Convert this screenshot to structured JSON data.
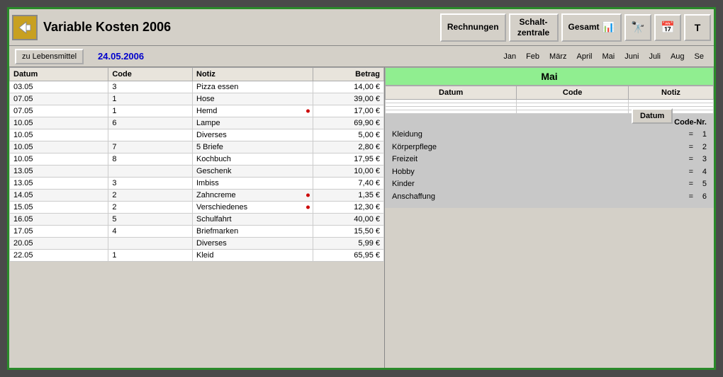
{
  "window": {
    "title": "Variable Kosten  2006",
    "border_color": "#2a8a2a"
  },
  "toolbar": {
    "rechnungen_label": "Rechnungen",
    "schaltzentrale_label": "Schalt-\nzentrale",
    "gesamt_label": "Gesamt"
  },
  "subtitle": {
    "lebensmittel_label": "zu Lebensmittel",
    "date": "24.05.2006"
  },
  "month_tabs": [
    "Jan",
    "Feb",
    "März",
    "April",
    "Mai",
    "Juni",
    "Juli",
    "Aug",
    "Se"
  ],
  "table": {
    "headers": [
      "Datum",
      "Code",
      "Notiz",
      "Betrag"
    ],
    "rows": [
      {
        "datum": "03.05",
        "code": "3",
        "notiz": "Pizza essen",
        "betrag": "14,00 €"
      },
      {
        "datum": "07.05",
        "code": "1",
        "notiz": "Hose",
        "betrag": "39,00 €"
      },
      {
        "datum": "07.05",
        "code": "1",
        "notiz": "Hemd",
        "betrag": "17,00 €"
      },
      {
        "datum": "10.05",
        "code": "6",
        "notiz": "Lampe",
        "betrag": "69,90 €"
      },
      {
        "datum": "10.05",
        "code": "",
        "notiz": "Diverses",
        "betrag": "5,00 €"
      },
      {
        "datum": "10.05",
        "code": "7",
        "notiz": "5 Briefe",
        "betrag": "2,80 €"
      },
      {
        "datum": "10.05",
        "code": "8",
        "notiz": "Kochbuch",
        "betrag": "17,95 €"
      },
      {
        "datum": "13.05",
        "code": "",
        "notiz": "Geschenk",
        "betrag": "10,00 €"
      },
      {
        "datum": "13.05",
        "code": "3",
        "notiz": "Imbiss",
        "betrag": "7,40 €"
      },
      {
        "datum": "14.05",
        "code": "2",
        "notiz": "Zahncreme",
        "betrag": "1,35 €"
      },
      {
        "datum": "15.05",
        "code": "2",
        "notiz": "Verschiedenes",
        "betrag": "12,30 €"
      },
      {
        "datum": "16.05",
        "code": "5",
        "notiz": "Schulfahrt",
        "betrag": "40,00 €"
      },
      {
        "datum": "17.05",
        "code": "4",
        "notiz": "Briefmarken",
        "betrag": "15,50 €"
      },
      {
        "datum": "20.05",
        "code": "",
        "notiz": "Diverses",
        "betrag": "5,99 €"
      },
      {
        "datum": "22.05",
        "code": "1",
        "notiz": "Kleid",
        "betrag": "65,95 €"
      }
    ]
  },
  "right_panel": {
    "month_header": "Mai",
    "table_headers": [
      "Datum",
      "Code",
      "Notiz"
    ],
    "datum_button": "Datum",
    "code_legend": {
      "title": "Code-Nr.",
      "items": [
        {
          "name": "Kleidung",
          "eq": "=",
          "num": "1"
        },
        {
          "name": "Körperpflege",
          "eq": "=",
          "num": "2"
        },
        {
          "name": "Freizeit",
          "eq": "=",
          "num": "3"
        },
        {
          "name": "Hobby",
          "eq": "=",
          "num": "4"
        },
        {
          "name": "Kinder",
          "eq": "=",
          "num": "5"
        },
        {
          "name": "Anschaffung",
          "eq": "=",
          "num": "6"
        }
      ]
    }
  }
}
